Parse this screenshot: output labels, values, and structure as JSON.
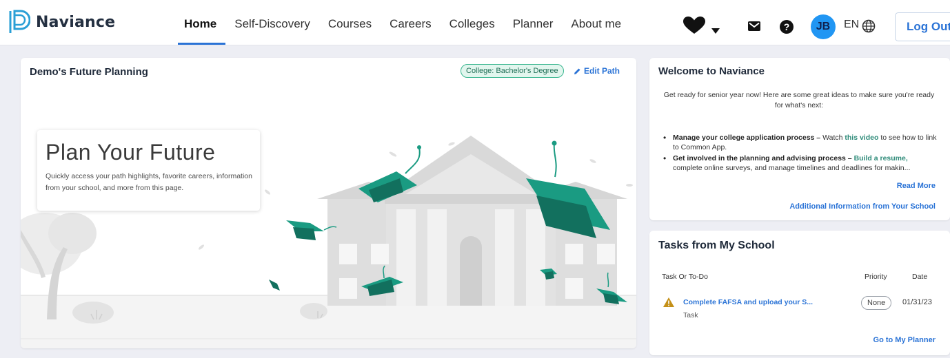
{
  "brand": {
    "name": "Naviance"
  },
  "nav": {
    "items": [
      {
        "label": "Home",
        "active": true
      },
      {
        "label": "Self-Discovery"
      },
      {
        "label": "Courses"
      },
      {
        "label": "Careers"
      },
      {
        "label": "Colleges"
      },
      {
        "label": "Planner"
      },
      {
        "label": "About me"
      }
    ]
  },
  "header": {
    "icons": [
      "heart-icon",
      "caret-down-icon",
      "mail-icon",
      "help-icon",
      "globe-icon"
    ],
    "avatar_initials": "JB",
    "language": "EN",
    "logout_label": "Log Out"
  },
  "future_card": {
    "title": "Demo's Future Planning",
    "badge": "College: Bachelor's Degree",
    "edit_label": "Edit Path",
    "hero_title": "Plan Your Future",
    "hero_desc": "Quickly access your path highlights, favorite careers, information from your school, and more from this page."
  },
  "welcome": {
    "title": "Welcome to Naviance",
    "intro": "Get ready for senior year now! Here are some great ideas to make sure you're ready for what's next:",
    "item1_bold": "Manage your college application process –",
    "item1_pre": "Watch",
    "item1_link": "this video",
    "item1_post": "to see how to link to Common App.",
    "item2_bold": "Get involved in the planning and advising process –",
    "item2_link": "Build a resume,",
    "item2_post": "complete online surveys, and manage timelines and deadlines for makin...",
    "read_more": "Read More",
    "additional": "Additional Information from Your School"
  },
  "tasks": {
    "title": "Tasks from My School",
    "columns": [
      "Task Or To-Do",
      "Priority",
      "Date"
    ],
    "rows": [
      {
        "name": "Complete FAFSA and upload your S...",
        "type": "Task",
        "priority": "None",
        "date": "01/31/23"
      }
    ],
    "goto_label": "Go to My Planner"
  },
  "colors": {
    "accent": "#2a73d6",
    "teal": "#1a9b82",
    "avatar": "#2196f3"
  }
}
